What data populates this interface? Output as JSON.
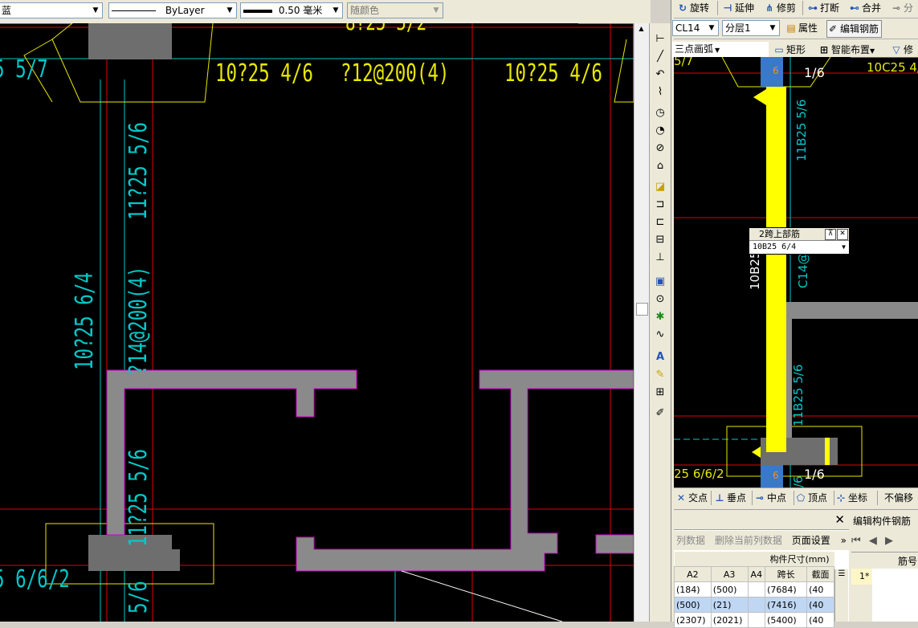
{
  "toolbar": {
    "color_value": "蓝",
    "linetype_value": "ByLayer",
    "lineweight_value": "0.50 毫米",
    "plotstyle_value": "随颜色"
  },
  "cad_left": {
    "texts": {
      "t_top_partial": "8?25 5/2",
      "t_top_left": "5 5/7",
      "t_top_mid": "10?25 4/6",
      "t_top_stirrup": "?12@200(4)",
      "t_top_right": "10?25 4/6",
      "t_col_right_top": "11?25 5/6",
      "t_col_left_mid": "10?25 6/4",
      "t_col_right_mid": "?14@200(4)",
      "t_col_right_bot": "11?25 5/6",
      "t_bottom_left": "5 6/6/2",
      "t_bottom_col": "5/6"
    }
  },
  "left_tools": [
    "line-icon",
    "ray-icon",
    "arc-icon",
    "polyline-icon",
    "circle-icon",
    "arc-3pt-icon",
    "no-entry-icon",
    "spline-icon",
    "hatch-icon",
    "dim-linear-icon",
    "dim-aligned-icon",
    "dim-baseline-icon",
    "dim-ordinate-icon",
    "block-icon",
    "point-icon",
    "snap-icon",
    "wave-icon",
    "text-icon",
    "pencil-icon",
    "align-icon",
    "edit-icon"
  ],
  "right_toolbar": {
    "rotate": "旋转",
    "extend": "延伸",
    "trim": "修剪",
    "break": "打断",
    "merge": "合并",
    "split": "分",
    "member": "CL14",
    "layer": "分层1",
    "properties": "属性",
    "edit_rebar": "编辑钢筋",
    "arc_mode": "三点画弧",
    "rect": "矩形",
    "smart_place": "智能布置",
    "modify": "修"
  },
  "cad_right": {
    "texts": {
      "r_top_left": "5/7",
      "r_top_ratio": "1/6",
      "r_top_right": "10C25 4/",
      "r_num_6a": "6",
      "r_vert_1": "11B25 5/6",
      "r_vert_left": "10B25 6/4",
      "r_vert_c14": "C14@",
      "r_vert_2": "11B25 5/6",
      "r_bot_ratio": "1/6",
      "r_bot_left": "25 6/6/2",
      "r_num_6b": "6",
      "r_bot_col": "/6"
    }
  },
  "popup": {
    "title": "2跨上部筋",
    "value": "10B25 6/4"
  },
  "snapbar": {
    "intersect": "交点",
    "perpendicular": "垂点",
    "midpoint": "中点",
    "vertex": "顶点",
    "coordinate": "坐标",
    "no_offset": "不偏移"
  },
  "bottom_panel": {
    "insert_col": "列数据",
    "delete_col": "删除当前列数据",
    "page_setup": "页面设置",
    "group_header": "构件尺寸(mm)",
    "columns": [
      "A2",
      "A3",
      "A4",
      "跨长",
      "截面"
    ],
    "rows": [
      [
        "(184)",
        "(500)",
        "",
        "(7684)",
        "(40"
      ],
      [
        "(500)",
        "(21)",
        "",
        "(7416)",
        "(40"
      ],
      [
        "(2307)",
        "(2021)",
        "",
        "(5400)",
        "(40"
      ]
    ]
  },
  "edit_panel": {
    "title": "编辑构件钢筋",
    "col_header": "筋号",
    "row1": "1*"
  }
}
